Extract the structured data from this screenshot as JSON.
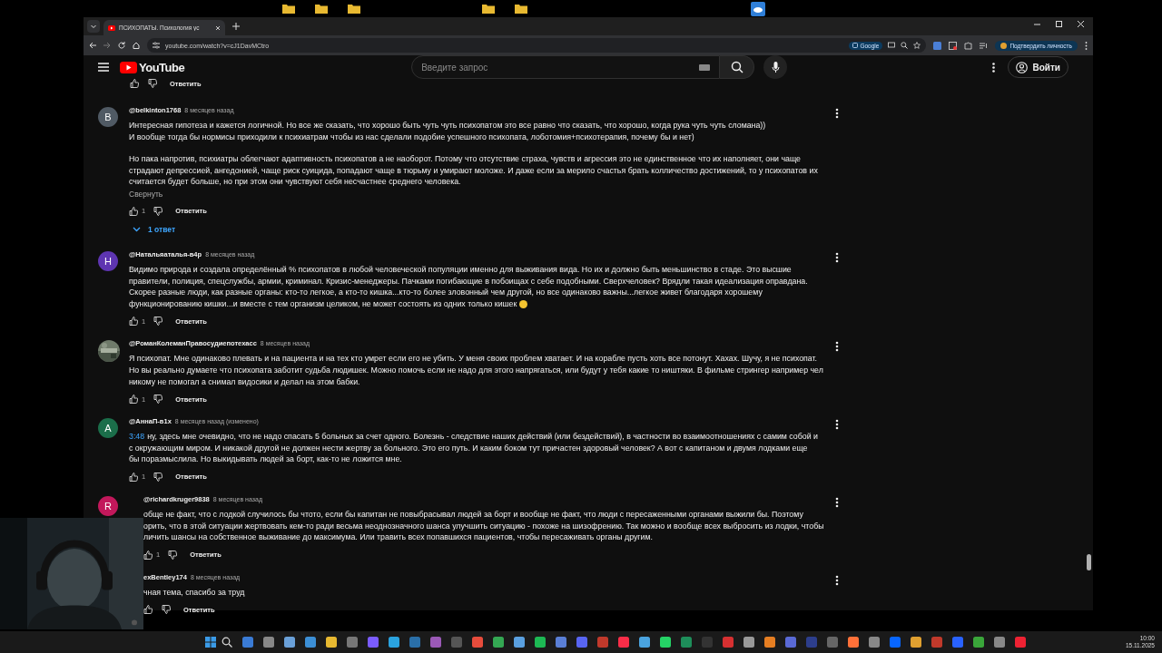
{
  "browser": {
    "tab_title": "ПСИХОПАТЫ. Психология ус",
    "url": "youtube.com/watch?v=cJ1DavMCtro",
    "google_chip": "Google",
    "verify_button": "Подтвердить личность"
  },
  "youtube": {
    "logo": "YouTube",
    "search_placeholder": "Введите запрос",
    "sign_in": "Войти"
  },
  "top_reply": "Ответить",
  "comments": [
    {
      "author": "@belkinton1768",
      "time": "8 месяцев назад",
      "avatar": {
        "kind": "letter",
        "letter": "B",
        "color": "#505a64"
      },
      "paragraphs": [
        [
          "Интересная гипотеза и кажется логичной. Но все же сказать, что хорошо быть чуть чуть психопатом это все равно что сказать, что хорошо, когда рука чуть чуть сломана))",
          "И вообще тогда бы нормисы приходили к психиатрам чтобы из нас сделали подобие успешного психопата, лоботомия+психотерапия, почему бы и нет)"
        ],
        [
          "Но пака напротив, психиатры облегчают адаптивность психопатов а не наоборот. Потому что отсутствие страха, чувств и агрессия это не единственное что их наполняет, они чаще",
          "страдают депрессией, ангедонией, чаще риск суицида, попадают чаще в тюрьму и умирают моложе. И даже если за мерило счастья брать колличество достижений, то у психопатов их",
          "считается будет больше, но при этом они чувствуют себя несчастнее среднего человека."
        ]
      ],
      "collapse": "Свернуть",
      "likes": "1",
      "reply": "Ответить",
      "replies": "1 ответ"
    },
    {
      "author": "@Натальяаталья-в4р",
      "time": "8 месяцев назад",
      "avatar": {
        "kind": "letter",
        "letter": "Н",
        "color": "#5e35b1"
      },
      "paragraphs": [
        [
          "Видимо природа и создала определённый % психопатов в любой человеческой популяции именно для выживания вида. Но их и должно быть меньшинство в стаде. Это высшие",
          "правители, полиция, спецслужбы, армии, криминал. Кризис-менеджеры. Пачками погибающие в побоищах с себе подобными.  Сверхчеловек? Врядли такая идеализация оправдана.",
          "Скорее разные люди, как разные органы: кто-то легкое, а кто-то кишка...кто-то более зловонный чем другой, но все одинаково важны...легкое живет  благодаря хорошему",
          "функционированию кишки...и вместе с тем организм целиком, не может состоять из одних только кишек"
        ]
      ],
      "emoji": true,
      "likes": "1",
      "reply": "Ответить"
    },
    {
      "author": "@РоманКолеманПравосудиепотехасс",
      "time": "8 месяцев назад",
      "avatar": {
        "kind": "picture"
      },
      "paragraphs": [
        [
          "Я психопат. Мне одинаково плевать и на пациента и на тех кто умрет если его не убить. У меня своих проблем хватает. И на корабле пусть хоть все потонут. Хахах. Шучу, я не психопат.",
          "Но вы реально думаете что психопата заботит судьба людишек. Можно помочь если не надо для этого напрягаться, или будут у тебя какие то ништяки. В фильме стрингер например чел",
          "никому не помогал а снимал видосики и делал на этом бабки."
        ]
      ],
      "likes": "1",
      "reply": "Ответить"
    },
    {
      "author": "@АннаП-в1х",
      "time": "8 месяцев назад (изменено)",
      "avatar": {
        "kind": "letter",
        "letter": "A",
        "color": "#1b6e4a"
      },
      "timestamp": "3:48",
      "paragraphs": [
        [
          "ну, здесь мне очевидно, что не надо спасать 5 больных за счет одного. Болезнь - следствие наших действий (или бездействий), в частности во взаимоотношениях с самим собой и",
          "с окружающим миром. И никакой другой не должен нести жертву за больного. Это его путь. И каким боком тут причастен здоровый человек? А вот с капитаном и двумя лодками еще",
          "бы поразмыслила. Но выкидывать людей за борт, как-то не ложится мне."
        ]
      ],
      "likes": "1",
      "reply": "Ответить"
    },
    {
      "author": "@richardkruger9838",
      "time": "8 месяцев назад",
      "avatar": {
        "kind": "letter",
        "letter": "R",
        "color": "#c2185b"
      },
      "covered": true,
      "paragraphs": [
        [
          "обще не факт, что с лодкой случилось бы чтото, если бы капитан не повыбрасывал людей за борт и вообще не факт, что люди с пересаженными органами выжили бы. Поэтому",
          "орить, что в этой ситуации жертвовать кем-то ради весьма неоднозначного шанса улучшить ситуацию - похоже на шизофрению. Так можно и вообще всех выбросить из лодки, чтобы",
          "личить шансы на собственное выживание до максимума. Или травить всех попавшихся пациентов, чтобы пересаживать органы другим."
        ]
      ],
      "likes": "1",
      "reply": "Ответить"
    },
    {
      "author": "exBentley174",
      "time": "8 месяцев назад",
      "covered": true,
      "paragraphs": [
        [
          "чная тема, спасибо за труд"
        ]
      ],
      "reply": "Ответить"
    }
  ],
  "taskbar": {
    "time": "10:00",
    "date": "15.11.2025"
  }
}
